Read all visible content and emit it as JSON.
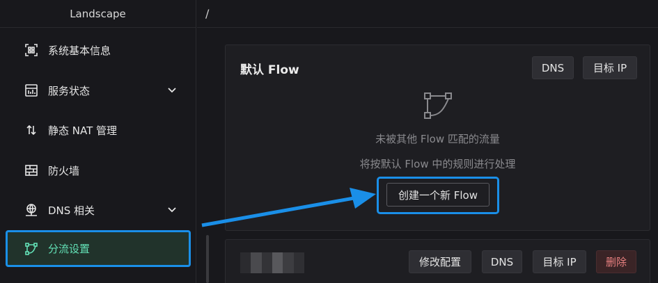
{
  "sidebar": {
    "brand": "Landscape",
    "items": [
      {
        "label": "系统基本信息",
        "icon": "dashboard-icon",
        "expandable": false
      },
      {
        "label": "服务状态",
        "icon": "status-panel-icon",
        "expandable": true
      },
      {
        "label": "静态 NAT 管理",
        "icon": "updown-arrows-icon",
        "expandable": false
      },
      {
        "label": "防火墙",
        "icon": "firewall-icon",
        "expandable": false
      },
      {
        "label": "DNS 相关",
        "icon": "dns-globe-icon",
        "expandable": true
      },
      {
        "label": "分流设置",
        "icon": "flow-split-icon",
        "expandable": false,
        "active": true
      }
    ]
  },
  "breadcrumb": {
    "path": "/"
  },
  "default_flow_card": {
    "title": "默认 Flow",
    "buttons": {
      "dns": "DNS",
      "target_ip": "目标 IP"
    },
    "empty_icon": "flow-split-icon",
    "empty_line1": "未被其他 Flow 匹配的流量",
    "empty_line2": "将按默认 Flow 中的规则进行处理",
    "create_button": "创建一个新 Flow"
  },
  "flow_card": {
    "buttons": {
      "edit": "修改配置",
      "dns": "DNS",
      "target_ip": "目标 IP",
      "delete": "删除"
    }
  },
  "colors": {
    "accent": "#63e2b7",
    "highlight": "#1a8fe8",
    "danger": "#e88080"
  }
}
